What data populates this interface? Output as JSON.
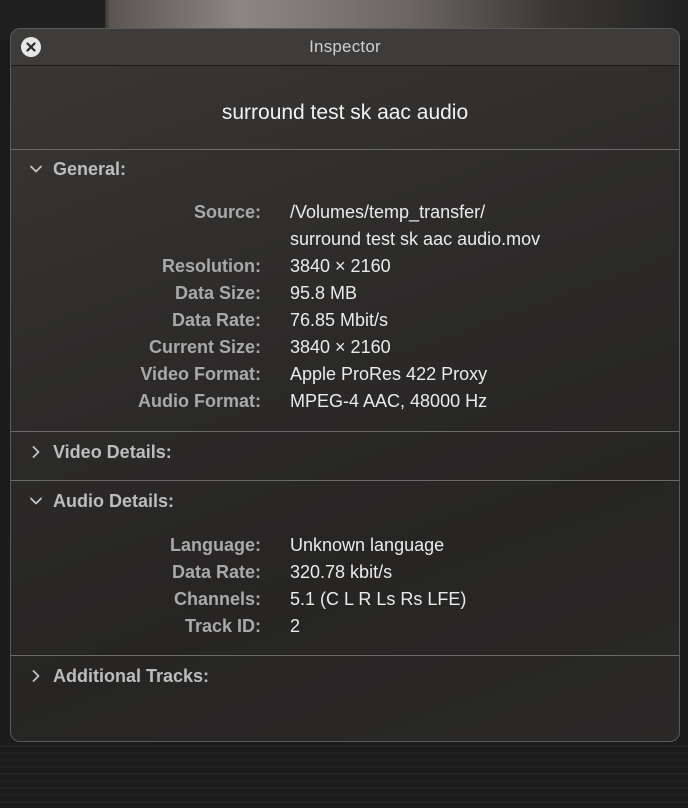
{
  "window": {
    "title": "Inspector",
    "file_name": "surround test sk aac audio"
  },
  "icons": {
    "close": "close-icon",
    "expanded": "chevron-down-icon",
    "collapsed": "chevron-right-icon"
  },
  "sections": {
    "general": {
      "title": "General:",
      "expanded": true,
      "rows": {
        "source": {
          "label": "Source:",
          "value_line1": "/Volumes/temp_transfer/",
          "value_line2": "surround test sk aac audio.mov"
        },
        "resolution": {
          "label": "Resolution:",
          "value": "3840 × 2160"
        },
        "data_size": {
          "label": "Data Size:",
          "value": "95.8 MB"
        },
        "data_rate": {
          "label": "Data Rate:",
          "value": "76.85 Mbit/s"
        },
        "current_size": {
          "label": "Current Size:",
          "value": "3840 × 2160"
        },
        "video_format": {
          "label": "Video Format:",
          "value": "Apple ProRes 422 Proxy"
        },
        "audio_format": {
          "label": "Audio Format:",
          "value": "MPEG-4 AAC, 48000 Hz"
        }
      }
    },
    "video_details": {
      "title": "Video Details:",
      "expanded": false
    },
    "audio_details": {
      "title": "Audio Details:",
      "expanded": true,
      "rows": {
        "language": {
          "label": "Language:",
          "value": "Unknown language"
        },
        "data_rate": {
          "label": "Data Rate:",
          "value": "320.78 kbit/s"
        },
        "channels": {
          "label": "Channels:",
          "value": "5.1 (C L R Ls Rs LFE)"
        },
        "track_id": {
          "label": "Track ID:",
          "value": "2"
        }
      }
    },
    "additional_tracks": {
      "title": "Additional Tracks:",
      "expanded": false
    }
  }
}
